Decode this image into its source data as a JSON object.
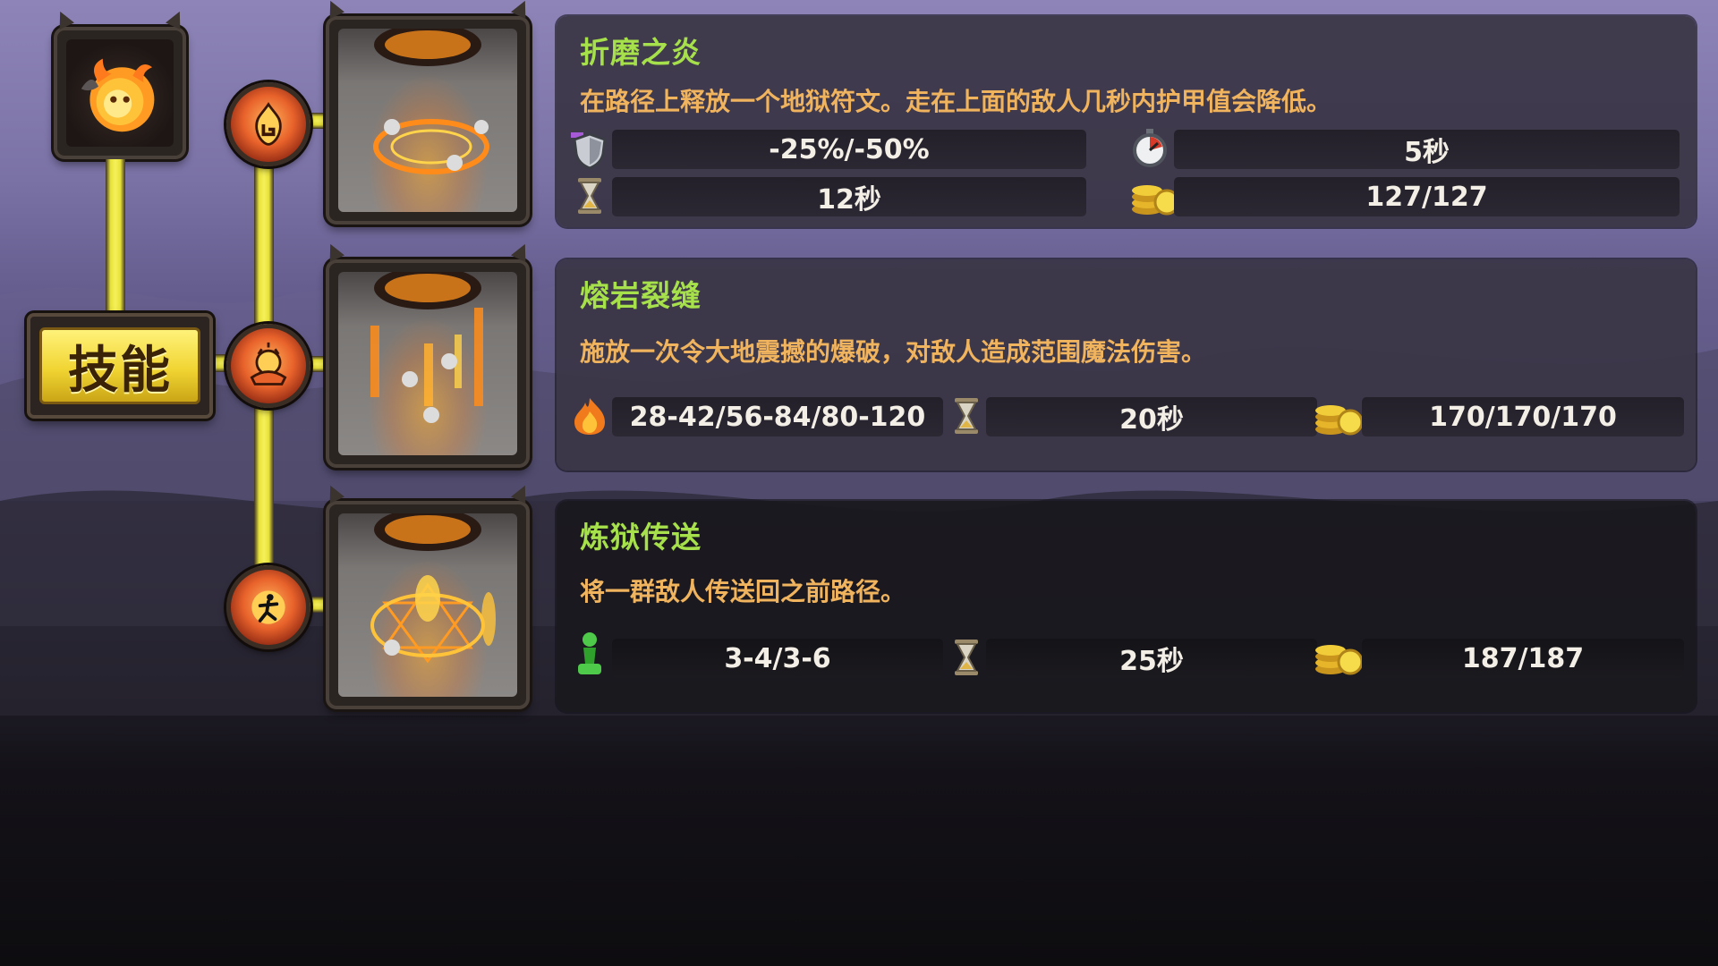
{
  "skill_tree": {
    "button_label": "技能",
    "tower_icon": "fireball-tower-icon",
    "upgrade_icons": [
      "fire-rune-icon",
      "lava-explosion-icon",
      "teleport-figure-icon"
    ]
  },
  "abilities": [
    {
      "title": "折磨之炎",
      "description": "在路径上释放一个地狱符文。走在上面的敌人几秒内护甲值会降低。",
      "stats": [
        {
          "icon": "armor-shield-icon",
          "value": "-25%/-50%"
        },
        {
          "icon": "stopwatch-icon",
          "value": "5秒"
        },
        {
          "icon": "hourglass-icon",
          "value": "12秒"
        },
        {
          "icon": "gold-coins-icon",
          "value": "127/127"
        }
      ]
    },
    {
      "title": "熔岩裂缝",
      "description": "施放一次令大地震撼的爆破，对敌人造成范围魔法伤害。",
      "stats": [
        {
          "icon": "fire-damage-icon",
          "value": "28-42/56-84/80-120"
        },
        {
          "icon": "hourglass-icon",
          "value": "20秒"
        },
        {
          "icon": "gold-coins-icon",
          "value": "170/170/170"
        }
      ]
    },
    {
      "title": "炼狱传送",
      "description": "将一群敌人传送回之前路径。",
      "stats": [
        {
          "icon": "pawn-icon",
          "value": "3-4/3-6"
        },
        {
          "icon": "hourglass-icon",
          "value": "25秒"
        },
        {
          "icon": "gold-coins-icon",
          "value": "187/187"
        }
      ]
    }
  ],
  "colors": {
    "title_green": "#a6e04a",
    "desc_orange": "#f0b35e",
    "rail_yellow": "#f6f05a",
    "button_gold": "#f1d533"
  }
}
